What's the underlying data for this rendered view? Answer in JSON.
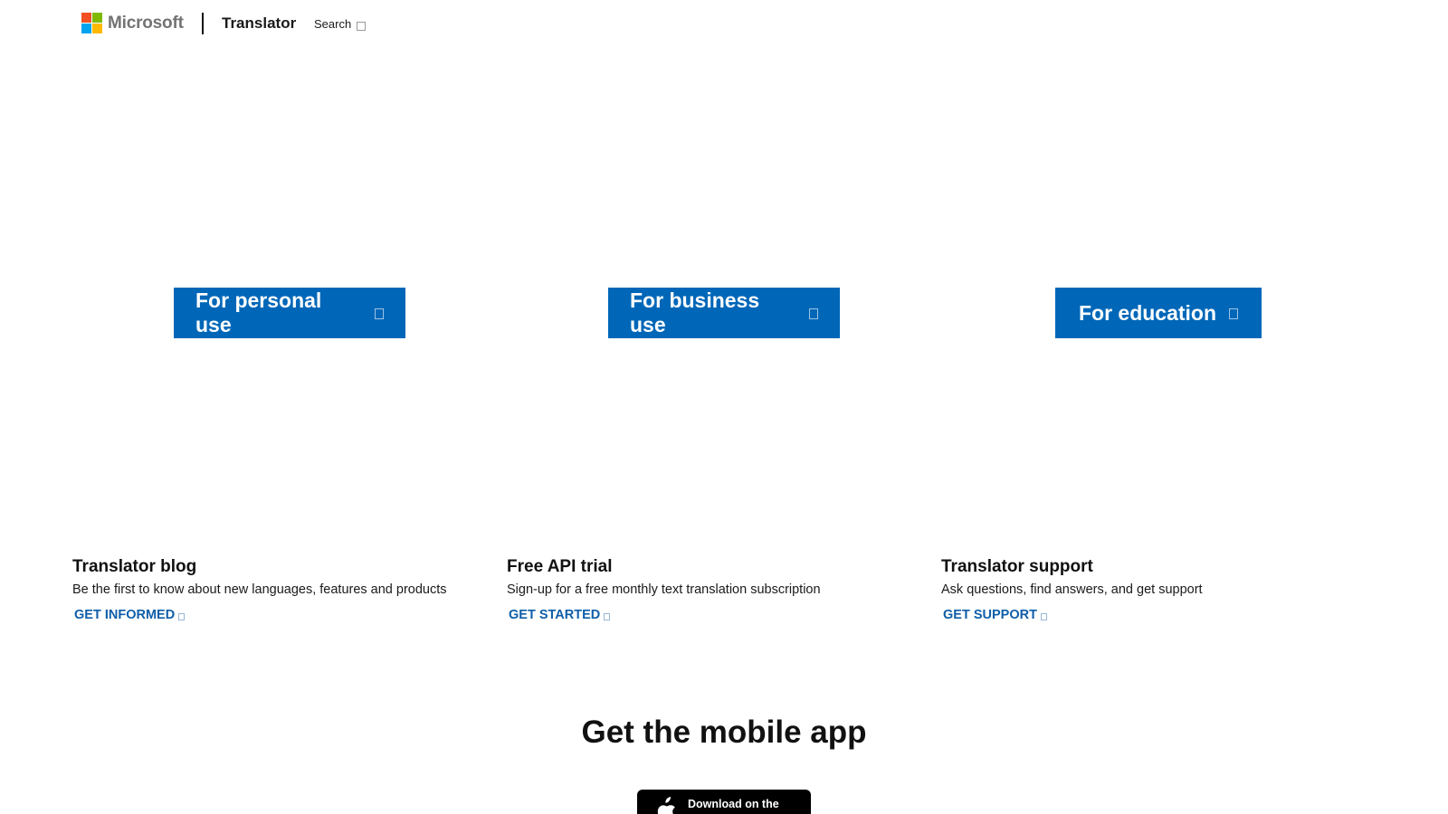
{
  "header": {
    "logo_text": "Microsoft",
    "brand": "Translator",
    "search_label": "Search",
    "logo_colors": [
      "#f25022",
      "#7fba00",
      "#00a4ef",
      "#ffb900"
    ]
  },
  "cta_buttons": [
    {
      "label": "For personal use"
    },
    {
      "label": "For business use"
    },
    {
      "label": "For education"
    }
  ],
  "info_columns": [
    {
      "title": "Translator blog",
      "description": "Be the first to know about new languages, features and products",
      "link": "GET INFORMED"
    },
    {
      "title": "Free API trial",
      "description": "Sign-up for a free monthly text translation subscription",
      "link": "GET STARTED"
    },
    {
      "title": "Translator support",
      "description": "Ask questions, find answers, and get support",
      "link": "GET SUPPORT"
    }
  ],
  "mobile": {
    "heading": "Get the mobile app",
    "app_store_line1": "Download on the"
  },
  "colors": {
    "accent": "#0067b8",
    "link": "#0f5ea8",
    "text": "#111111"
  }
}
